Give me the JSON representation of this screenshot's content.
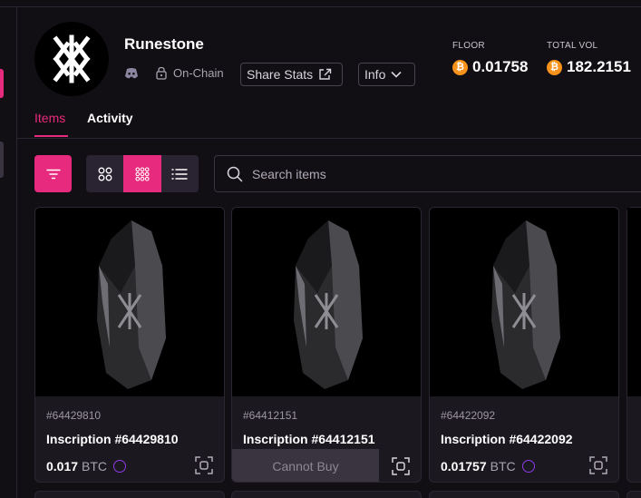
{
  "collection": {
    "title": "Runestone",
    "onchain_label": "On-Chain",
    "share_label": "Share Stats",
    "info_label": "Info"
  },
  "stats": {
    "floor_label": "FLOOR",
    "floor_value": "0.01758",
    "volume_label": "TOTAL VOL",
    "volume_value": "182.2151"
  },
  "tabs": [
    {
      "label": "Items",
      "active": true
    },
    {
      "label": "Activity",
      "active": false
    }
  ],
  "search": {
    "placeholder": "Search items"
  },
  "colors": {
    "accent": "#e72a7d",
    "btc": "#f7931a",
    "rune": "#8a3de8"
  },
  "cards": [
    {
      "number": "#64429810",
      "name": "Inscription #64429810",
      "price": "0.017",
      "unit": "BTC"
    },
    {
      "number": "#64412151",
      "name": "Inscription #64412151",
      "action": "Cannot Buy"
    },
    {
      "number": "#64422092",
      "name": "Inscription #64422092",
      "price": "0.01757",
      "unit": "BTC"
    }
  ]
}
